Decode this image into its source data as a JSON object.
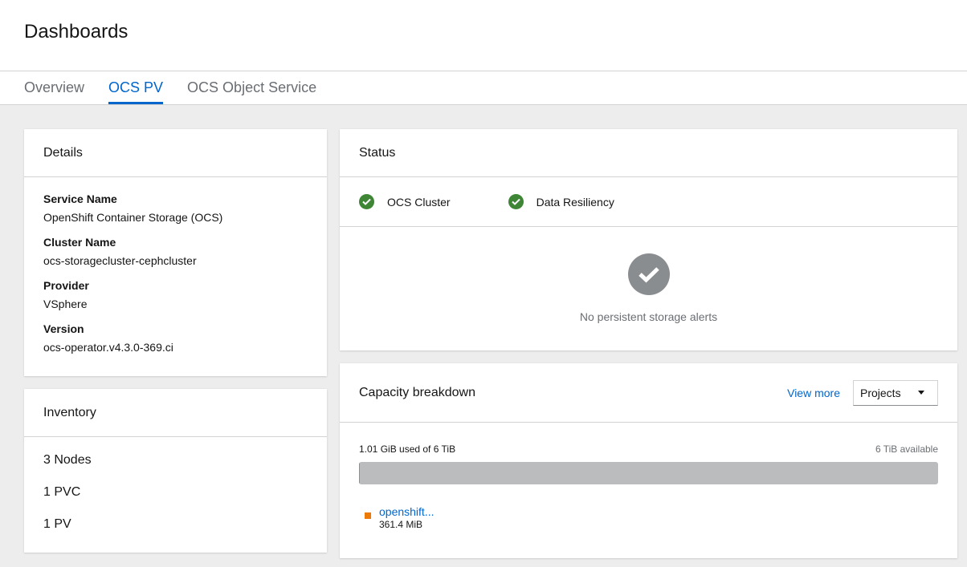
{
  "header": {
    "title": "Dashboards"
  },
  "tabs": [
    {
      "label": "Overview",
      "active": false
    },
    {
      "label": "OCS PV",
      "active": true
    },
    {
      "label": "OCS Object Service",
      "active": false
    }
  ],
  "details": {
    "title": "Details",
    "fields": [
      {
        "label": "Service Name",
        "value": "OpenShift Container Storage (OCS)"
      },
      {
        "label": "Cluster Name",
        "value": "ocs-storagecluster-cephcluster"
      },
      {
        "label": "Provider",
        "value": "VSphere"
      },
      {
        "label": "Version",
        "value": "ocs-operator.v4.3.0-369.ci"
      }
    ]
  },
  "inventory": {
    "title": "Inventory",
    "items": [
      "3 Nodes",
      "1 PVC",
      "1 PV"
    ]
  },
  "status": {
    "title": "Status",
    "items": [
      {
        "label": "OCS Cluster",
        "icon": "check-circle-icon",
        "color": "#3e8635"
      },
      {
        "label": "Data Resiliency",
        "icon": "check-circle-icon",
        "color": "#3e8635"
      }
    ],
    "empty_message": "No persistent storage alerts"
  },
  "capacity": {
    "title": "Capacity breakdown",
    "view_more": "View more",
    "select_value": "Projects",
    "used_text": "1.01 GiB used of 6 TiB",
    "available_text": "6 TiB available",
    "used_fraction": 0.00016,
    "legend": [
      {
        "name": "openshift...",
        "value": "361.4 MiB",
        "color": "#ec7a08"
      }
    ]
  },
  "colors": {
    "accent": "#0066cc",
    "success": "#3e8635",
    "background": "#ededed"
  }
}
